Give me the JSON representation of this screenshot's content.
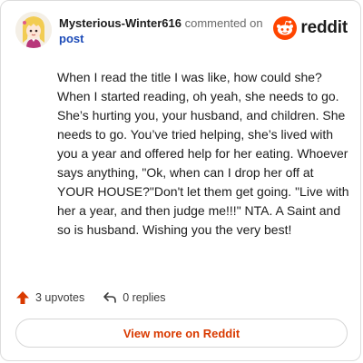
{
  "header": {
    "username": "Mysterious-Winter616",
    "commented_text": "commented on",
    "post_link": "post",
    "brand_name": "reddit"
  },
  "comment": {
    "body": "When I read the title I was like, how could she? When I started reading, oh yeah, she needs to go. She’s hurting you, your husband, and children. She needs to go. You’ve tried helping, she’s lived with you a year and offered help for her eating. Whoever says anything, \"Ok, when can I drop her off at YOUR HOUSE?\"Don't let them get going. \"Live with her a year, and then judge me!!!\" NTA. A Saint and so is husband. Wishing you the very best!"
  },
  "actions": {
    "upvotes_label": "3 upvotes",
    "replies_label": "0 replies"
  },
  "footer": {
    "view_more_label": "View more on Reddit"
  },
  "colors": {
    "brand": "#ff4500",
    "upvote": "#d93a00",
    "link": "#1c4bb8"
  }
}
